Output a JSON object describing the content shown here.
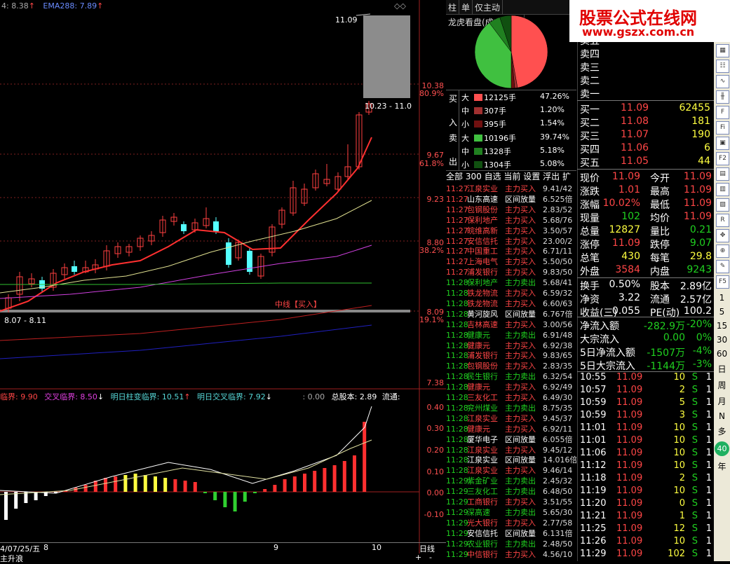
{
  "chart": {
    "header_items": [
      "4: 8.38",
      "EMA288: 7.89"
    ],
    "price_axis": [
      "11.09",
      "10.38",
      "80.9%",
      "9.67",
      "61.8%",
      "9.23",
      "8.80",
      "38.2%",
      "8.09",
      "19.1%",
      "7.38"
    ],
    "box_label": "11.09",
    "range_label_top": "10.23 - 11.0",
    "range_label_bottom": "8.07 - 8.11",
    "signal_label": "中线【买入】",
    "indicator_header": [
      "临界: 9.90",
      "交叉临界: 8.50",
      "明日柱变临界: 10.51",
      "明日交叉临界: 7.92",
      ": 0.00",
      "总股本: 2.89",
      "流通:"
    ],
    "indicator_axis": [
      "0.40",
      "0.30",
      "0.20",
      "0.10",
      "0.00",
      "-0.10"
    ],
    "date_labels": [
      "4/07/25/五",
      "8",
      "9",
      "10"
    ],
    "period_label": "日线",
    "bottom_left": "主升浪",
    "bottom_right": [
      "+",
      "-"
    ]
  },
  "tabs": [
    "柱",
    "单",
    "仅主动",
    "龙虎看盘(成交量/按"
  ],
  "flow": {
    "buy_label": [
      "买",
      "入"
    ],
    "sell_label": [
      "卖",
      "出"
    ],
    "buy_rows": [
      {
        "size": "大",
        "vol": "12125手",
        "pct": "47.26%",
        "color": "#ff5050"
      },
      {
        "size": "中",
        "vol": "307手",
        "pct": "1.20%",
        "color": "#a03030"
      },
      {
        "size": "小",
        "vol": "395手",
        "pct": "1.54%",
        "color": "#701010"
      }
    ],
    "sell_rows": [
      {
        "size": "大",
        "vol": "10196手",
        "pct": "39.74%",
        "color": "#40c040"
      },
      {
        "size": "中",
        "vol": "1328手",
        "pct": "5.18%",
        "color": "#208020"
      },
      {
        "size": "小",
        "vol": "1304手",
        "pct": "5.08%",
        "color": "#105010"
      }
    ],
    "pie": [
      47.26,
      1.2,
      1.54,
      39.74,
      5.18,
      5.08
    ]
  },
  "list_tabs": [
    "全部",
    "300",
    "自选",
    "当前",
    "设置",
    "浮出",
    "扩"
  ],
  "radar": [
    {
      "t": "11:27",
      "n": "江泉实业",
      "a": "主力买入",
      "v": "9.41/42"
    },
    {
      "t": "11:27",
      "n": "山东高速",
      "a": "区间放量",
      "v": "6.525倍"
    },
    {
      "t": "11:27",
      "n": "包钢股份",
      "a": "主力买入",
      "v": "2.83/52"
    },
    {
      "t": "11:27",
      "n": "保利地产",
      "a": "主力买入",
      "v": "5.68/76"
    },
    {
      "t": "11:27",
      "n": "皖维高新",
      "a": "主力买入",
      "v": "3.50/57"
    },
    {
      "t": "11:27",
      "n": "安信信托",
      "a": "主力买入",
      "v": "23.00/2"
    },
    {
      "t": "11:27",
      "n": "中国重工",
      "a": "主力买入",
      "v": "6.71/11"
    },
    {
      "t": "11:27",
      "n": "上海电气",
      "a": "主力买入",
      "v": "5.50/50"
    },
    {
      "t": "11:27",
      "n": "浦发银行",
      "a": "主力买入",
      "v": "9.83/50"
    },
    {
      "t": "11:28",
      "n": "保利地产",
      "a": "主力卖出",
      "v": "5.68/41"
    },
    {
      "t": "11:28",
      "n": "铁龙物流",
      "a": "主力买入",
      "v": "6.59/32"
    },
    {
      "t": "11:28",
      "n": "铁龙物流",
      "a": "主力买入",
      "v": "6.60/63"
    },
    {
      "t": "11:28",
      "n": "黄河旋风",
      "a": "区间放量",
      "v": "6.767倍"
    },
    {
      "t": "11:28",
      "n": "吉林高速",
      "a": "主力买入",
      "v": "3.00/56"
    },
    {
      "t": "11:28",
      "n": "健康元",
      "a": "主力卖出",
      "v": "6.91/48"
    },
    {
      "t": "11:28",
      "n": "健康元",
      "a": "主力买入",
      "v": "6.92/38"
    },
    {
      "t": "11:28",
      "n": "浦发银行",
      "a": "主力买入",
      "v": "9.83/65"
    },
    {
      "t": "11:28",
      "n": "包钢股份",
      "a": "主力买入",
      "v": "2.83/35"
    },
    {
      "t": "11:28",
      "n": "民生银行",
      "a": "主力卖出",
      "v": "6.32/54"
    },
    {
      "t": "11:28",
      "n": "健康元",
      "a": "主力买入",
      "v": "6.92/49"
    },
    {
      "t": "11:28",
      "n": "三友化工",
      "a": "主力买入",
      "v": "6.49/30"
    },
    {
      "t": "11:28",
      "n": "兖州煤业",
      "a": "主力卖出",
      "v": "8.75/35"
    },
    {
      "t": "11:28",
      "n": "江泉实业",
      "a": "主力买入",
      "v": "9.45/37"
    },
    {
      "t": "11:28",
      "n": "健康元",
      "a": "主力买入",
      "v": "6.92/11"
    },
    {
      "t": "11:28",
      "n": "厦华电子",
      "a": "区间放量",
      "v": "6.055倍"
    },
    {
      "t": "11:28",
      "n": "江泉实业",
      "a": "主力买入",
      "v": "9.45/12"
    },
    {
      "t": "11:28",
      "n": "江泉实业",
      "a": "区间放量",
      "v": "14.016倍"
    },
    {
      "t": "11:28",
      "n": "江泉实业",
      "a": "主力买入",
      "v": "9.46/14"
    },
    {
      "t": "11:29",
      "n": "紫金矿业",
      "a": "主力卖出",
      "v": "2.45/32"
    },
    {
      "t": "11:29",
      "n": "三友化工",
      "a": "主力卖出",
      "v": "6.48/50"
    },
    {
      "t": "11:29",
      "n": "工商银行",
      "a": "主力买入",
      "v": "3.51/55"
    },
    {
      "t": "11:29",
      "n": "深高速",
      "a": "主力卖出",
      "v": "5.65/30"
    },
    {
      "t": "11:29",
      "n": "光大银行",
      "a": "主力买入",
      "v": "2.77/58"
    },
    {
      "t": "11:29",
      "n": "安信信托",
      "a": "区间放量",
      "v": "6.131倍"
    },
    {
      "t": "11:29",
      "n": "农业银行",
      "a": "主力卖出",
      "v": "2.48/50"
    },
    {
      "t": "11:29",
      "n": "中信银行",
      "a": "主力买入",
      "v": "4.56/10"
    }
  ],
  "orderbook": {
    "sells_partial": [
      "卖五",
      "卖四",
      "卖三",
      "卖二",
      "卖一"
    ],
    "buys": [
      {
        "l": "买一",
        "p": "11.09",
        "v": "62455"
      },
      {
        "l": "买二",
        "p": "11.08",
        "v": "181"
      },
      {
        "l": "买三",
        "p": "11.07",
        "v": "190"
      },
      {
        "l": "买四",
        "p": "11.06",
        "v": "6"
      },
      {
        "l": "买五",
        "p": "11.05",
        "v": "44"
      }
    ]
  },
  "quote": [
    {
      "a": "现价",
      "av": "11.09",
      "b": "今开",
      "bv": "11.09"
    },
    {
      "a": "涨跌",
      "av": "1.01",
      "b": "最高",
      "bv": "11.09"
    },
    {
      "a": "涨幅",
      "av": "10.02%",
      "b": "最低",
      "bv": "11.09"
    },
    {
      "a": "现量",
      "av": "102",
      "b": "均价",
      "bv": "11.09"
    },
    {
      "a": "总量",
      "av": "12827",
      "b": "量比",
      "bv": "0.21"
    },
    {
      "a": "涨停",
      "av": "11.09",
      "b": "跌停",
      "bv": "9.07"
    },
    {
      "a": "总笔",
      "av": "430",
      "b": "每笔",
      "bv": "29.8"
    },
    {
      "a": "外盘",
      "av": "3584",
      "b": "内盘",
      "bv": "9243"
    }
  ],
  "fund": [
    {
      "a": "换手",
      "av": "0.50%",
      "b": "股本",
      "bv": "2.89亿"
    },
    {
      "a": "净资",
      "av": "3.22",
      "b": "流通",
      "bv": "2.57亿"
    },
    {
      "a": "收益(三)",
      "av": "0.055",
      "b": "PE(动)",
      "bv": "100.2"
    }
  ],
  "capital": [
    {
      "l": "净流入额",
      "v": "-282.9万",
      "p": "-20%"
    },
    {
      "l": "大宗流入",
      "v": "0.00",
      "p": "0%"
    },
    {
      "l": "5日净流入额",
      "v": "-1507万",
      "p": "-4%"
    },
    {
      "l": "5日大宗流入",
      "v": "-1144万",
      "p": "-3%"
    }
  ],
  "deals": [
    {
      "t": "10:55",
      "p": "11.09",
      "v": "10",
      "s": "S",
      "n": "1"
    },
    {
      "t": "10:57",
      "p": "11.09",
      "v": "2",
      "s": "S",
      "n": "1"
    },
    {
      "t": "10:59",
      "p": "11.09",
      "v": "5",
      "s": "S",
      "n": "1"
    },
    {
      "t": "10:59",
      "p": "11.09",
      "v": "3",
      "s": "S",
      "n": "1"
    },
    {
      "t": "11:01",
      "p": "11.09",
      "v": "10",
      "s": "S",
      "n": "1"
    },
    {
      "t": "11:01",
      "p": "11.09",
      "v": "10",
      "s": "S",
      "n": "1"
    },
    {
      "t": "11:06",
      "p": "11.09",
      "v": "10",
      "s": "S",
      "n": "1"
    },
    {
      "t": "11:12",
      "p": "11.09",
      "v": "10",
      "s": "S",
      "n": "1"
    },
    {
      "t": "11:18",
      "p": "11.09",
      "v": "2",
      "s": "S",
      "n": "1"
    },
    {
      "t": "11:19",
      "p": "11.09",
      "v": "10",
      "s": "S",
      "n": "1"
    },
    {
      "t": "11:20",
      "p": "11.09",
      "v": "0",
      "s": "S",
      "n": "1"
    },
    {
      "t": "11:21",
      "p": "11.09",
      "v": "1",
      "s": "S",
      "n": "1"
    },
    {
      "t": "11:25",
      "p": "11.09",
      "v": "12",
      "s": "S",
      "n": "1"
    },
    {
      "t": "11:26",
      "p": "11.09",
      "v": "10",
      "s": "S",
      "n": "1"
    },
    {
      "t": "11:29",
      "p": "11.09",
      "v": "102",
      "s": "S",
      "n": "1"
    }
  ],
  "banner": {
    "title": "股票公式在线网",
    "url": "www.gszx.com.cn"
  },
  "sidebar_text": [
    "1",
    "5",
    "15",
    "30",
    "60",
    "日",
    "周",
    "月",
    "N",
    "多",
    "40",
    "年"
  ]
}
